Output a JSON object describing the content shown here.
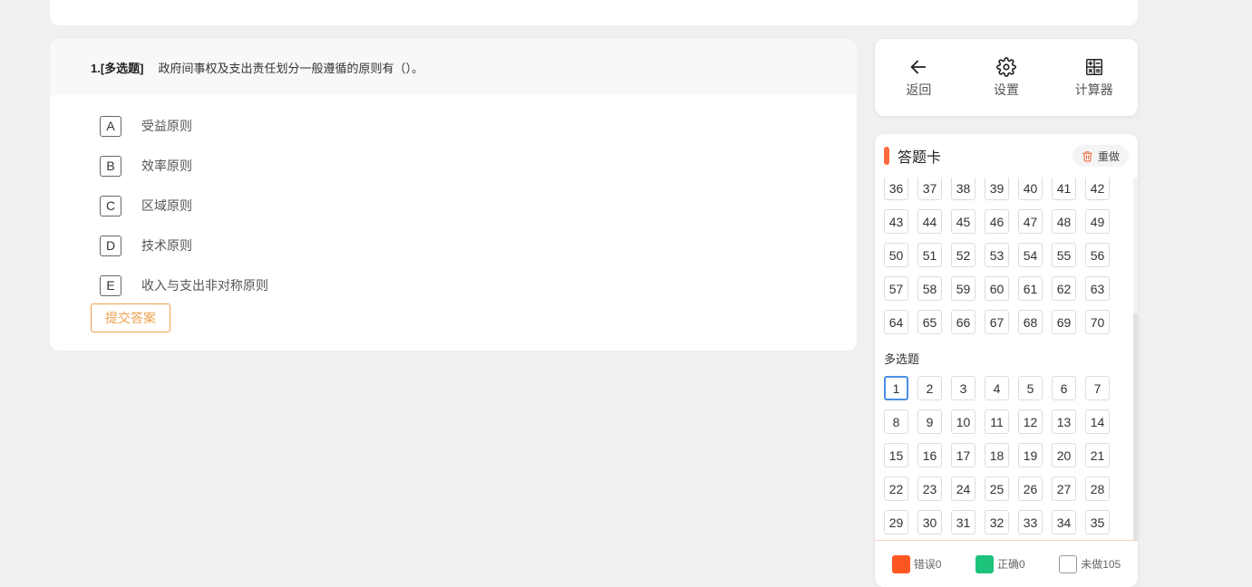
{
  "question": {
    "prefix": "1.[多选题]",
    "text": "政府间事权及支出责任划分一般遵循的原则有（）。",
    "options": [
      {
        "letter": "A",
        "text": "受益原则"
      },
      {
        "letter": "B",
        "text": "效率原则"
      },
      {
        "letter": "C",
        "text": "区域原则"
      },
      {
        "letter": "D",
        "text": "技术原则"
      },
      {
        "letter": "E",
        "text": "收入与支出非对称原则"
      }
    ],
    "submit_label": "提交答案"
  },
  "tools": {
    "back_label": "返回",
    "settings_label": "设置",
    "calculator_label": "计算器"
  },
  "answer_sheet": {
    "title": "答题卡",
    "redo_label": "重做",
    "single_numbers": [
      "36",
      "37",
      "38",
      "39",
      "40",
      "41",
      "42",
      "43",
      "44",
      "45",
      "46",
      "47",
      "48",
      "49",
      "50",
      "51",
      "52",
      "53",
      "54",
      "55",
      "56",
      "57",
      "58",
      "59",
      "60",
      "61",
      "62",
      "63",
      "64",
      "65",
      "66",
      "67",
      "68",
      "69",
      "70"
    ],
    "multi_section_label": "多选题",
    "multi_numbers": [
      "1",
      "2",
      "3",
      "4",
      "5",
      "6",
      "7",
      "8",
      "9",
      "10",
      "11",
      "12",
      "13",
      "14",
      "15",
      "16",
      "17",
      "18",
      "19",
      "20",
      "21",
      "22",
      "23",
      "24",
      "25",
      "26",
      "27",
      "28",
      "29",
      "30",
      "31",
      "32",
      "33",
      "34",
      "35"
    ],
    "current": "1"
  },
  "legend": {
    "wrong_label": "错误0",
    "correct_label": "正确0",
    "undone_label": "未做105",
    "wrong_color": "#ff5722",
    "correct_color": "#1dc37a",
    "undone_color": "#ffffff"
  }
}
